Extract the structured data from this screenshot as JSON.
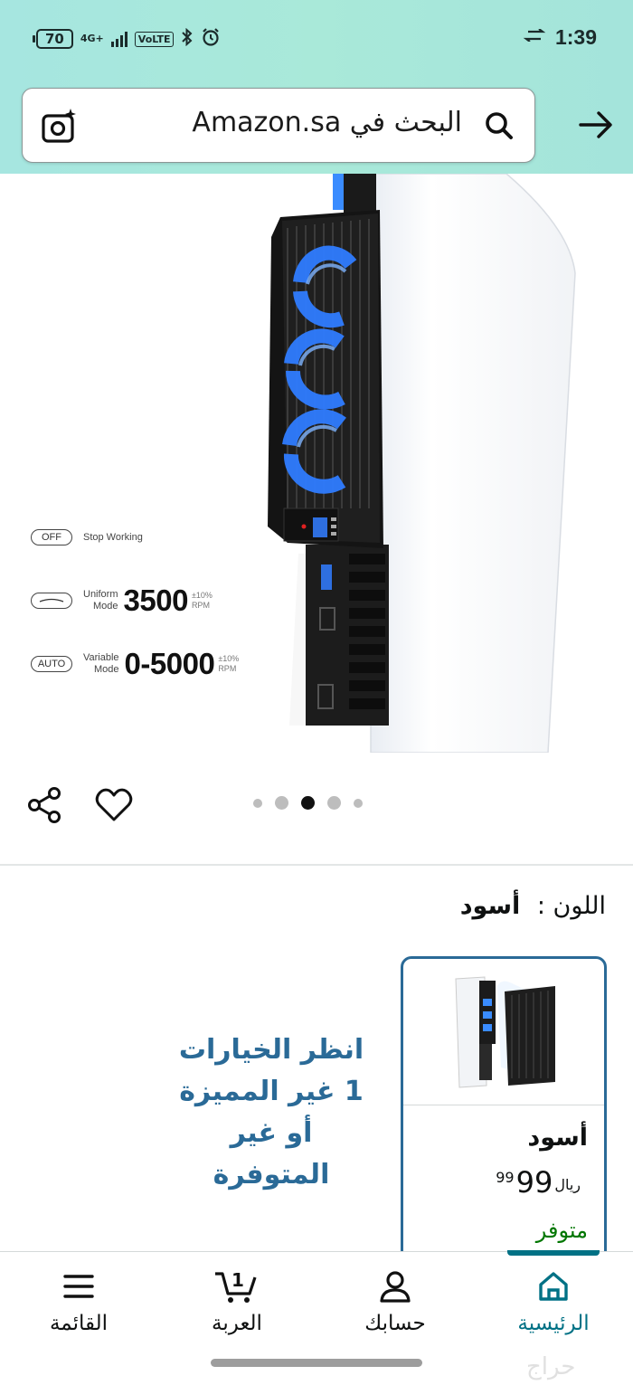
{
  "status_bar": {
    "battery": "70",
    "network": "4G+",
    "volte": "VoLTE",
    "time": "1:39"
  },
  "search": {
    "query_placeholder": "البحث في Amazon.sa"
  },
  "product_image": {
    "modes": [
      {
        "badge": "OFF",
        "label": "Stop Working",
        "value": "",
        "tolerance": "",
        "unit": ""
      },
      {
        "badge": "",
        "label_line1": "Uniform",
        "label_line2": "Mode",
        "value": "3500",
        "tolerance": "±10%",
        "unit": "RPM"
      },
      {
        "badge": "AUTO",
        "label_line1": "Variable",
        "label_line2": "Mode",
        "value": "0-5000",
        "tolerance": "±10%",
        "unit": "RPM"
      }
    ],
    "carousel": {
      "count": 5,
      "active_index": 2
    }
  },
  "color_selector": {
    "label": "اللون :",
    "value": "أسود"
  },
  "see_options": {
    "line1": "انظر الخيارات",
    "line2": "1 غير المميزة",
    "line3": "أو غير",
    "line4": "المتوفرة"
  },
  "swatch": {
    "name": "أسود",
    "price_currency": "ريال",
    "price_whole": "99",
    "price_fraction": "99",
    "availability": "متوفر"
  },
  "bottom_nav": {
    "home": "الرئيسية",
    "account": "حسابك",
    "cart": "العربة",
    "cart_count": "1",
    "menu": "القائمة"
  },
  "watermark": "حراج",
  "colors": {
    "header_gradient": "#a6e6e0",
    "accent_teal": "#007185",
    "link_blue": "#2a6a97",
    "in_stock_green": "#007600"
  }
}
